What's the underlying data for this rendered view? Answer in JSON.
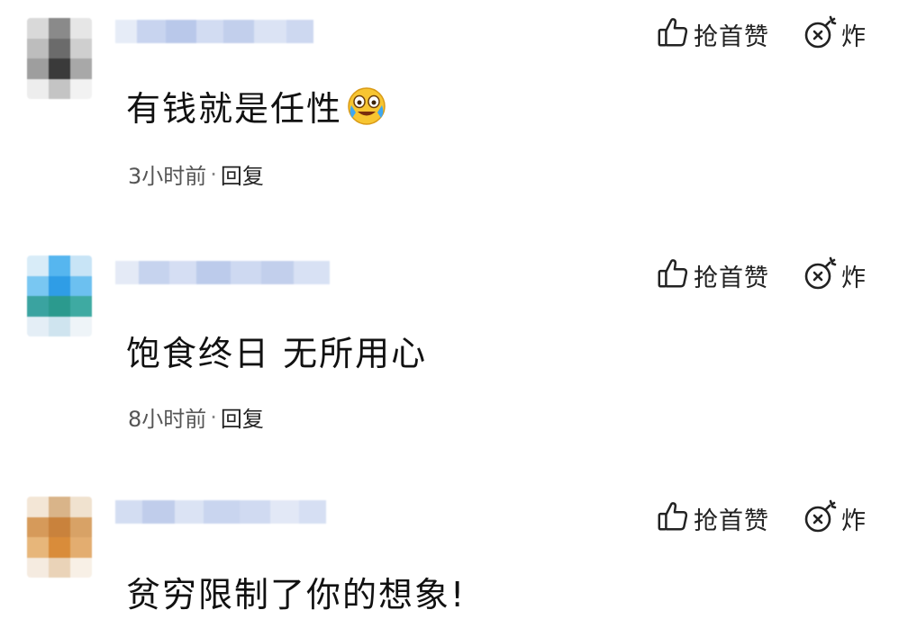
{
  "comments": [
    {
      "content": "有钱就是任性",
      "emoji": "crying-laughing-emoji",
      "time": "3小时前",
      "separator": "·",
      "reply_label": "回复",
      "like_label": "抢首赞",
      "bomb_label": "炸"
    },
    {
      "content": "饱食终日 无所用心",
      "time": "8小时前",
      "separator": "·",
      "reply_label": "回复",
      "like_label": "抢首赞",
      "bomb_label": "炸"
    },
    {
      "content": "贫穷限制了你的想象!",
      "like_label": "抢首赞",
      "bomb_label": "炸"
    }
  ],
  "icons": {
    "like": "thumbs-up-icon",
    "bomb": "bomb-icon"
  },
  "colors": {
    "text": "#111111",
    "meta": "#555555",
    "background": "#ffffff"
  }
}
